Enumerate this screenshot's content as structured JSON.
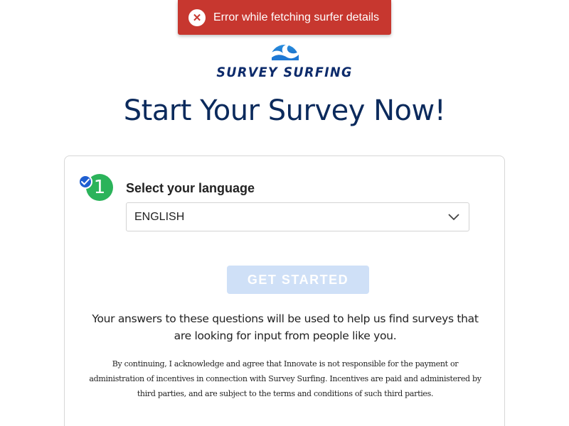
{
  "toast": {
    "message": "Error while fetching surfer details",
    "icon": "close-circle-icon",
    "color": "#c7372f"
  },
  "logo": {
    "text": "SURVEY SURFING",
    "icon": "wave-icon",
    "color": "#0d2b6b"
  },
  "page": {
    "title": "Start Your Survey Now!"
  },
  "step1": {
    "number": "1",
    "label": "Select your language",
    "check_icon": "checkmark-icon",
    "language_selected": "ENGLISH"
  },
  "cta": {
    "label": "GET STARTED",
    "color": "#cfe0f7"
  },
  "info": {
    "text": "Your answers to these questions will be used to help us find surveys that are looking for input from people like you."
  },
  "legal": {
    "text": "By continuing, I acknowledge and agree that Innovate is not responsible for the payment or administration of incentives in connection with Survey Surfing. Incentives are paid and administered by third parties, and are subject to the terms and conditions of such third parties."
  }
}
